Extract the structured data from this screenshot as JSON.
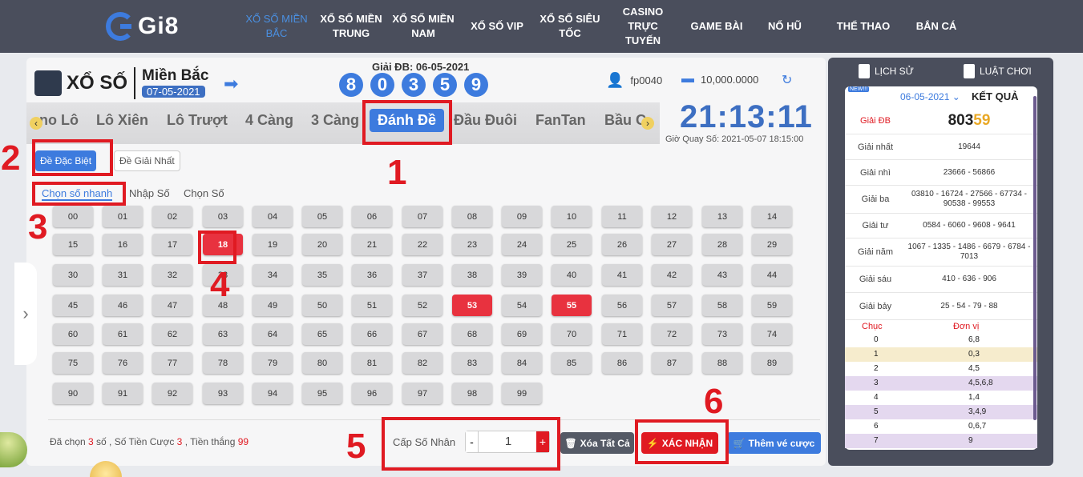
{
  "logo": {
    "text": "Gi8"
  },
  "nav": [
    {
      "label": "XỔ SỐ MIỀN BẮC"
    },
    {
      "label": "XỔ SỐ MIỀN TRUNG"
    },
    {
      "label": "XỔ SỐ MIỀN NAM"
    },
    {
      "label": "XỔ SỐ VIP"
    },
    {
      "label": "XỔ SỐ SIÊU TỐC"
    },
    {
      "label": "CASINO TRỰC TUYẾN"
    },
    {
      "label": "GAME BÀI"
    },
    {
      "label": "NỔ HŨ"
    },
    {
      "label": "THỂ THAO"
    },
    {
      "label": "BẮN CÁ"
    }
  ],
  "header": {
    "xoso": "XỔ SỐ",
    "region": "Miền Bắc",
    "date": "07-05-2021",
    "gdb_label": "Giải ĐB: 06-05-2021",
    "balls": [
      "8",
      "0",
      "3",
      "5",
      "9"
    ]
  },
  "account": {
    "user": "fp0040",
    "balance": "10,000.0000"
  },
  "tabs": [
    "no Lô",
    "Lô Xiên",
    "Lô Trượt",
    "4 Càng",
    "3 Càng",
    "Đánh Đề",
    "Đầu Đuôi",
    "FanTan",
    "Bầu C"
  ],
  "clock": {
    "time": "21:13:11",
    "next": "Giờ Quay Số: 2021-05-07 18:15:00"
  },
  "sub_tabs": [
    "Đề Đặc Biệt",
    "Đề Giải Nhất"
  ],
  "modes": [
    "Chọn số nhanh",
    "Nhập Số",
    "Chọn Số"
  ],
  "grid": {
    "numbers": [
      "00",
      "01",
      "02",
      "03",
      "04",
      "05",
      "06",
      "07",
      "08",
      "09",
      "10",
      "11",
      "12",
      "13",
      "14",
      "15",
      "16",
      "17",
      "18",
      "19",
      "20",
      "21",
      "22",
      "23",
      "24",
      "25",
      "26",
      "27",
      "28",
      "29",
      "30",
      "31",
      "32",
      "33",
      "34",
      "35",
      "36",
      "37",
      "38",
      "39",
      "40",
      "41",
      "42",
      "43",
      "44",
      "45",
      "46",
      "47",
      "48",
      "49",
      "50",
      "51",
      "52",
      "53",
      "54",
      "55",
      "56",
      "57",
      "58",
      "59",
      "60",
      "61",
      "62",
      "63",
      "64",
      "65",
      "66",
      "67",
      "68",
      "69",
      "70",
      "71",
      "72",
      "73",
      "74",
      "75",
      "76",
      "77",
      "78",
      "79",
      "80",
      "81",
      "82",
      "83",
      "84",
      "85",
      "86",
      "87",
      "88",
      "89",
      "90",
      "91",
      "92",
      "93",
      "94",
      "95",
      "96",
      "97",
      "98",
      "99"
    ],
    "selected": [
      "18",
      "53",
      "55"
    ]
  },
  "summary": {
    "p1": "Đã chọn ",
    "count": "3",
    "p2": " số , Số Tiền Cược ",
    "bet": "3",
    "p3": " , Tiền thắng ",
    "win": "99"
  },
  "multiplier": {
    "label": "Cấp Số Nhân",
    "minus": "-",
    "value": "1",
    "plus": "+"
  },
  "buttons": {
    "clear": "Xóa Tất Cả",
    "confirm": "XÁC NHẬN",
    "add": "Thêm vé cược"
  },
  "annotations": [
    "1",
    "2",
    "3",
    "4",
    "5",
    "6"
  ],
  "results_panel": {
    "history": "LỊCH SỬ",
    "rules": "LUẬT CHƠI",
    "new": "NEW!!!",
    "date": "06-05-2021 ⌄",
    "title": "KẾT QUẢ",
    "db_label": "Giải ĐB",
    "db_black": "803",
    "db_gold": "59",
    "prizes": [
      {
        "label": "Giải nhất",
        "value": "19644"
      },
      {
        "label": "Giải nhì",
        "value": "23666 - 56866"
      },
      {
        "label": "Giải ba",
        "value": "03810 - 16724 - 27566 - 67734 - 90538 - 99553"
      },
      {
        "label": "Giải tư",
        "value": "0584 - 6060 - 9608 - 9641"
      },
      {
        "label": "Giải năm",
        "value": "1067 - 1335 - 1486 - 6679 - 6784 - 7013"
      },
      {
        "label": "Giải sáu",
        "value": "410 - 636 - 906"
      },
      {
        "label": "Giải bảy",
        "value": "25 - 54 - 79 - 88"
      }
    ],
    "loto_head": {
      "chuc": "Chục",
      "donvi": "Đơn vị"
    },
    "loto": [
      {
        "c": "0",
        "d": "6,8",
        "color": "#ffffff"
      },
      {
        "c": "1",
        "d": "0,3",
        "color": "#f6eccd"
      },
      {
        "c": "2",
        "d": "4,5",
        "color": "#ffffff"
      },
      {
        "c": "3",
        "d": "4,5,6,8",
        "color": "#e4d8ef"
      },
      {
        "c": "4",
        "d": "1,4",
        "color": "#ffffff"
      },
      {
        "c": "5",
        "d": "3,4,9",
        "color": "#e4d8ef"
      },
      {
        "c": "6",
        "d": "0,6,7",
        "color": "#ffffff"
      },
      {
        "c": "7",
        "d": "9",
        "color": "#e4d8ef"
      }
    ]
  }
}
